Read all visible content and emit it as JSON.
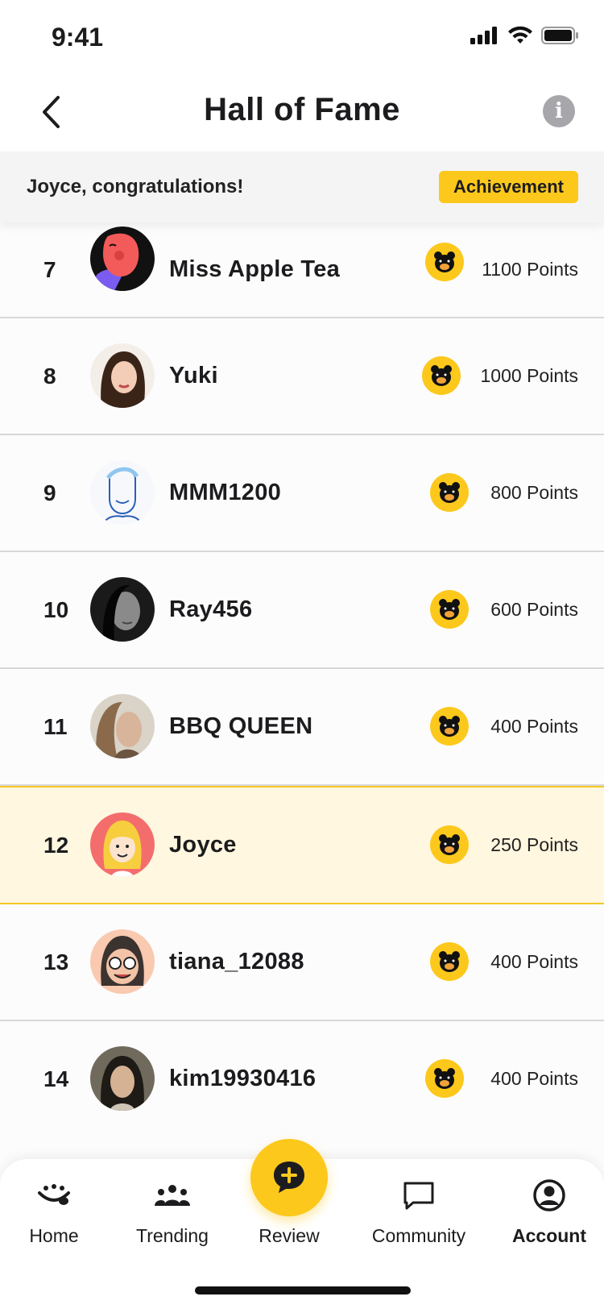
{
  "status_bar": {
    "time": "9:41"
  },
  "header": {
    "title": "Hall of Fame"
  },
  "banner": {
    "message": "Joyce, congratulations!",
    "button_label": "Achievement"
  },
  "leaderboard": [
    {
      "rank": "7",
      "name": "Miss Apple Tea",
      "points": "1100 Points",
      "avatar": "avatar-illustrated-woman",
      "badge": "bear-badge-icon"
    },
    {
      "rank": "8",
      "name": "Yuki",
      "points": "1000 Points",
      "avatar": "avatar-photo",
      "badge": "bear-badge-icon"
    },
    {
      "rank": "9",
      "name": "MMM1200",
      "points": "800 Points",
      "avatar": "avatar-sketch-man",
      "badge": "bear-badge-icon"
    },
    {
      "rank": "10",
      "name": "Ray456",
      "points": "600 Points",
      "avatar": "avatar-photo-bw",
      "badge": "bear-badge-icon"
    },
    {
      "rank": "11",
      "name": "BBQ QUEEN",
      "points": "400 Points",
      "avatar": "avatar-photo",
      "badge": "bear-badge-icon"
    },
    {
      "rank": "12",
      "name": "Joyce",
      "points": "250 Points",
      "avatar": "avatar-cartoon-girl",
      "badge": "bear-badge-icon",
      "current_user": true
    },
    {
      "rank": "13",
      "name": "tiana_12088",
      "points": "400 Points",
      "avatar": "avatar-memoji",
      "badge": "bear-badge-icon"
    },
    {
      "rank": "14",
      "name": "kim19930416",
      "points": "400 Points",
      "avatar": "avatar-photo",
      "badge": "bear-badge-icon"
    }
  ],
  "tabbar": {
    "home": "Home",
    "trending": "Trending",
    "review": "Review",
    "community": "Community",
    "account": "Account",
    "active": "account"
  },
  "colors": {
    "accent": "#fcc81c",
    "highlight_row": "#fff7df",
    "highlight_border": "#f7c726"
  }
}
